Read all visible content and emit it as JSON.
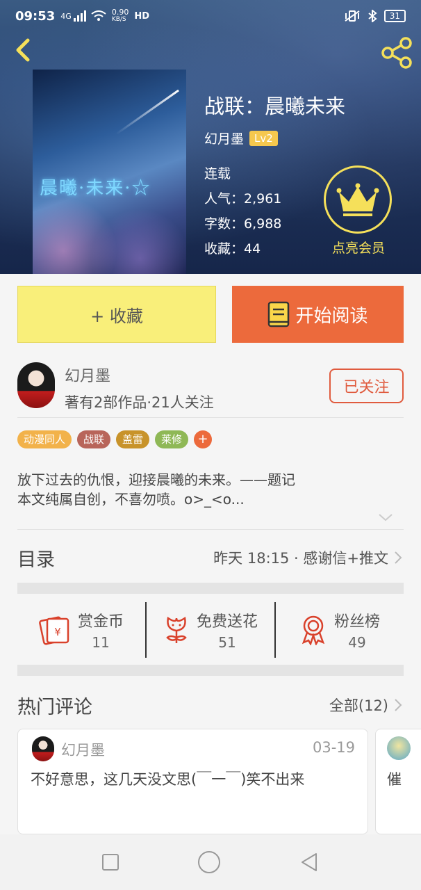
{
  "status_bar": {
    "time": "09:53",
    "network": "4G",
    "speed": "0.90",
    "speed_unit": "KB/S",
    "hd": "HD",
    "battery": "31"
  },
  "book": {
    "title": "战联：晨曦未来",
    "author": "幻月墨",
    "level": "Lv2",
    "status": "连载",
    "popularity": "人气：2,961",
    "word_count": "字数：6,988",
    "favorites": "收藏：44",
    "cover_text": "晨曦·未来·☆"
  },
  "vip": {
    "label": "点亮会员"
  },
  "actions": {
    "collect_label": "+ 收藏",
    "read_label": "开始阅读"
  },
  "author_card": {
    "name": "幻月墨",
    "meta": "著有2部作品·21人关注",
    "follow_label": "已关注"
  },
  "tags": [
    {
      "label": "动漫同人",
      "color": "#f2b24a"
    },
    {
      "label": "战联",
      "color": "#b8655a"
    },
    {
      "label": "盖雷",
      "color": "#c8932a"
    },
    {
      "label": "莱修",
      "color": "#8fb856"
    },
    {
      "label": "+",
      "color": "#ec6a3c"
    }
  ],
  "description": {
    "line1": "放下过去的仇恨，迎接晨曦的未来。——题记",
    "line2": "本文纯属自创，不喜勿喷。o>_<o..."
  },
  "toc": {
    "title": "目录",
    "latest": "昨天 18:15 · 感谢信+推文"
  },
  "rewards": [
    {
      "label": "赏金币",
      "value": "11",
      "icon": "coin-envelope-icon"
    },
    {
      "label": "免费送花",
      "value": "51",
      "icon": "flower-icon"
    },
    {
      "label": "粉丝榜",
      "value": "49",
      "icon": "medal-icon"
    }
  ],
  "comments_section": {
    "title": "热门评论",
    "all_label": "全部(12)"
  },
  "comments": [
    {
      "user": "幻月墨",
      "date": "03-19",
      "text": "不好意思，这几天没文思(￣一￣)笑不出来"
    },
    {
      "user": "",
      "date": "",
      "text": "催"
    }
  ],
  "colors": {
    "accent_orange": "#ec6a3c",
    "collect_yellow": "#f9ef7a",
    "vip_gold": "#f5e05a",
    "icon_red": "#d9412b"
  }
}
